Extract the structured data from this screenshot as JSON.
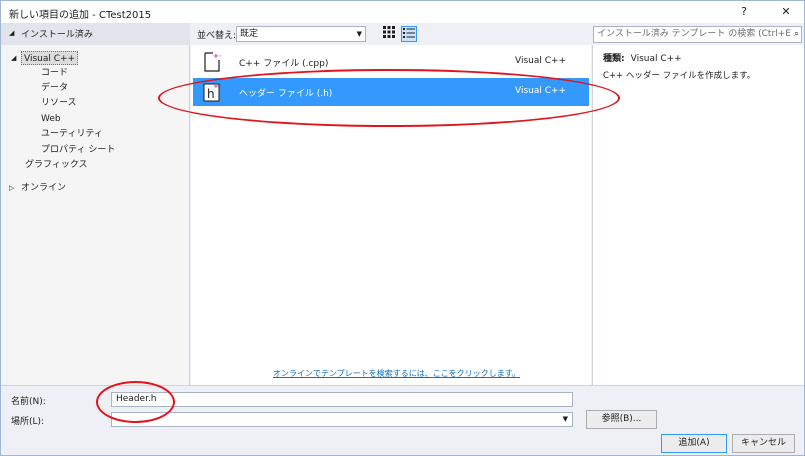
{
  "window": {
    "title": "新しい項目の追加 - CTest2015",
    "help_glyph": "?",
    "close_glyph": "✕"
  },
  "sidebar": {
    "installed_label": "インストール済み",
    "items": [
      {
        "label": "Visual C++"
      },
      {
        "label": "コード"
      },
      {
        "label": "データ"
      },
      {
        "label": "リソース"
      },
      {
        "label": "Web"
      },
      {
        "label": "ユーティリティ"
      },
      {
        "label": "プロパティ シート"
      },
      {
        "label": "グラフィックス"
      }
    ],
    "online_label": "オンライン"
  },
  "toolbar": {
    "sort_label": "並べ替え:",
    "sort_value": "既定",
    "search_placeholder": "インストール済み テンプレート の検索 (Ctrl+E)",
    "search_icon_glyph": "⌕"
  },
  "templates": [
    {
      "name": "C++ ファイル (.cpp)",
      "category": "Visual C++",
      "icon": "cpp-file-icon",
      "selected": false
    },
    {
      "name": "ヘッダー ファイル (.h)",
      "category": "Visual C++",
      "icon": "header-file-icon",
      "selected": true
    }
  ],
  "online_link": "オンラインでテンプレートを検索するには、ここをクリックします。",
  "details": {
    "type_label": "種類:",
    "type_value": "Visual C++",
    "description": "C++ ヘッダー ファイルを作成します。"
  },
  "form": {
    "name_label": "名前(N):",
    "name_value": "Header.h",
    "location_label": "場所(L):",
    "location_value": "",
    "browse_button": "参照(B)...",
    "add_button": "追加(A)",
    "cancel_button": "キャンセル"
  },
  "colors": {
    "selection": "#3399ff",
    "annotation": "#e0141c",
    "link": "#0e70c0"
  }
}
